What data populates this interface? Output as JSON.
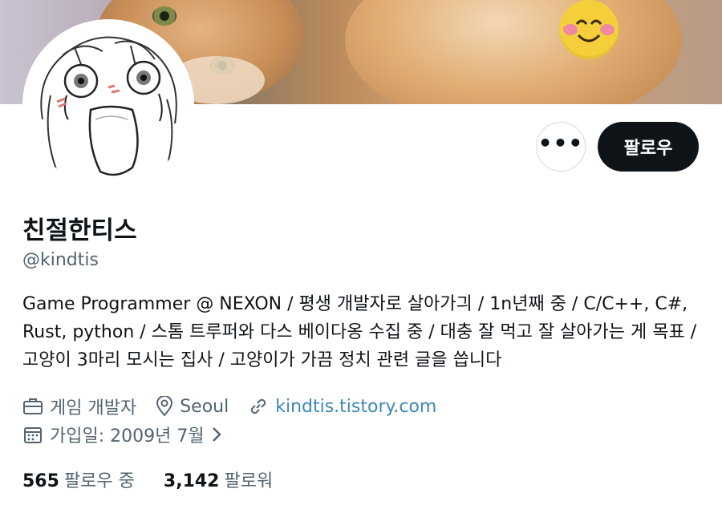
{
  "profile": {
    "display_name": "친절한티스",
    "handle": "@kindtis",
    "bio": "Game Programmer @ NEXON / 평생 개발자로 살아가긔 / 1n년째 중 / C/C++, C#, Rust, python / 스톰 트루퍼와 다스 베이다옹 수집 중 / 대충 잘 먹고 잘 살아가는 게 목표 / 고양이 3마리 모시는 집사 / 고양이가 가끔 정치 관련 글을 씁니다",
    "category": "게임 개발자",
    "location": "Seoul",
    "website": "kindtis.tistory.com",
    "joined": "가입일: 2009년 7월"
  },
  "actions": {
    "more_label": "•••",
    "follow_label": "팔로우"
  },
  "stats": {
    "following_count": "565",
    "following_label": "팔로우 중",
    "followers_count": "3,142",
    "followers_label": "팔로워"
  },
  "icons": {
    "category": "briefcase-icon",
    "location": "map-pin-icon",
    "website": "link-icon",
    "joined": "calendar-icon",
    "joined_more": "chevron-right-icon",
    "more": "more-horizontal-icon"
  },
  "colors": {
    "primary_text": "#0f1419",
    "secondary_text": "#536471",
    "link": "#3f88b5",
    "follow_button_bg": "#0f1419",
    "follow_button_text": "#ffffff"
  }
}
